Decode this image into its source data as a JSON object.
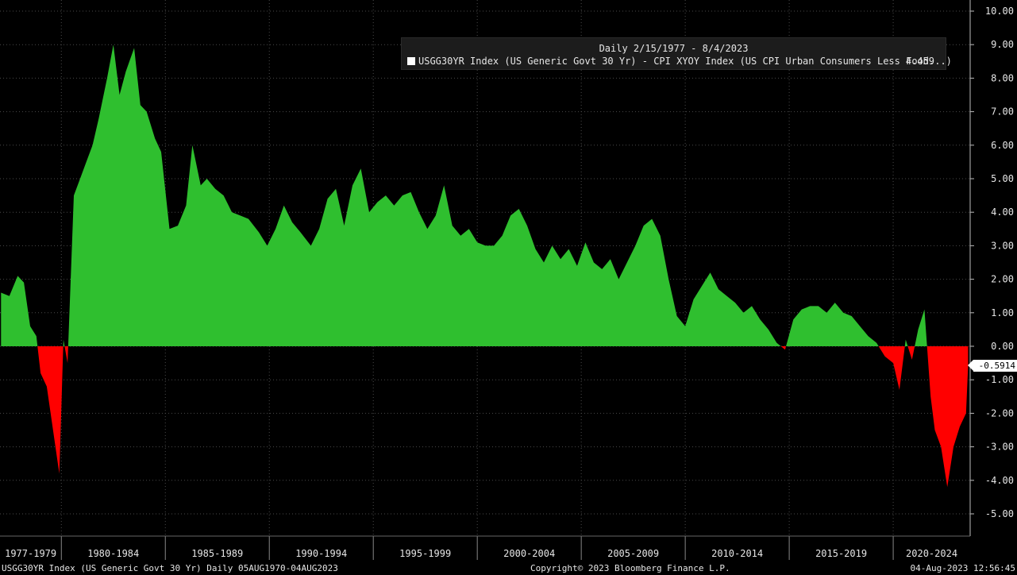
{
  "chart_data": {
    "type": "area",
    "title": "Daily 2/15/1977 - 8/4/2023",
    "series": [
      {
        "name": "USGG30YR Index (US Generic Govt 30 Yr) - CPI XYOY Index (US CPI Urban Consumers Less Food...)",
        "last_value": "4.459",
        "x": [
          1977.1,
          1977.5,
          1977.9,
          1978.2,
          1978.5,
          1978.8,
          1979.0,
          1979.3,
          1979.6,
          1979.9,
          1980.1,
          1980.3,
          1980.6,
          1980.9,
          1981.2,
          1981.5,
          1981.8,
          1982.2,
          1982.5,
          1982.8,
          1983.1,
          1983.5,
          1983.8,
          1984.1,
          1984.5,
          1984.8,
          1985.2,
          1985.6,
          1986.0,
          1986.3,
          1986.7,
          1987.0,
          1987.4,
          1987.8,
          1988.2,
          1988.6,
          1989.0,
          1989.5,
          1989.9,
          1990.3,
          1990.7,
          1991.1,
          1991.5,
          1992.0,
          1992.4,
          1992.8,
          1993.2,
          1993.6,
          1994.0,
          1994.4,
          1994.8,
          1995.2,
          1995.6,
          1996.0,
          1996.4,
          1996.8,
          1997.2,
          1997.6,
          1998.0,
          1998.4,
          1998.8,
          1999.2,
          1999.6,
          2000.0,
          2000.4,
          2000.8,
          2001.2,
          2001.6,
          2002.0,
          2002.4,
          2002.8,
          2003.2,
          2003.6,
          2004.0,
          2004.4,
          2004.8,
          2005.2,
          2005.6,
          2006.0,
          2006.4,
          2006.8,
          2007.2,
          2007.6,
          2008.0,
          2008.4,
          2008.8,
          2009.2,
          2009.6,
          2010.0,
          2010.4,
          2010.8,
          2011.2,
          2011.6,
          2012.0,
          2012.4,
          2012.8,
          2013.2,
          2013.6,
          2014.0,
          2014.4,
          2014.8,
          2015.2,
          2015.6,
          2016.0,
          2016.4,
          2016.8,
          2017.2,
          2017.6,
          2018.0,
          2018.4,
          2018.8,
          2019.2,
          2019.6,
          2020.0,
          2020.3,
          2020.6,
          2020.9,
          2021.2,
          2021.5,
          2021.8,
          2022.0,
          2022.3,
          2022.6,
          2022.9,
          2023.2,
          2023.5,
          2023.6
        ],
        "values": [
          1.6,
          1.5,
          2.1,
          1.9,
          0.6,
          0.3,
          -0.8,
          -1.2,
          -2.5,
          -3.8,
          0.2,
          -0.5,
          4.5,
          5.0,
          5.5,
          6.0,
          6.8,
          8.0,
          9.0,
          7.5,
          8.2,
          8.9,
          7.2,
          7.0,
          6.2,
          5.8,
          3.5,
          3.6,
          4.2,
          6.0,
          4.8,
          5.0,
          4.7,
          4.5,
          4.0,
          3.9,
          3.8,
          3.4,
          3.0,
          3.5,
          4.2,
          3.7,
          3.4,
          3.0,
          3.5,
          4.4,
          4.7,
          3.6,
          4.8,
          5.3,
          4.0,
          4.3,
          4.5,
          4.2,
          4.5,
          4.6,
          4.0,
          3.5,
          3.9,
          4.8,
          3.6,
          3.3,
          3.5,
          3.1,
          3.0,
          3.0,
          3.3,
          3.9,
          4.1,
          3.6,
          2.9,
          2.5,
          3.0,
          2.6,
          2.9,
          2.4,
          3.1,
          2.5,
          2.3,
          2.6,
          2.0,
          2.5,
          3.0,
          3.6,
          3.8,
          3.3,
          2.0,
          0.9,
          0.6,
          1.4,
          1.8,
          2.2,
          1.7,
          1.5,
          1.3,
          1.0,
          1.2,
          0.8,
          0.5,
          0.1,
          -0.1,
          0.8,
          1.1,
          1.2,
          1.2,
          1.0,
          1.3,
          1.0,
          0.9,
          0.6,
          0.3,
          0.1,
          -0.3,
          -0.5,
          -1.3,
          0.2,
          -0.4,
          0.5,
          1.1,
          -1.5,
          -2.5,
          -3.0,
          -4.2,
          -3.0,
          -2.4,
          -2.0,
          -0.59
        ]
      }
    ],
    "last_value_label": "-0.5914",
    "xlim": [
      1977.05,
      1923.6
    ],
    "ylim": [
      -5.5,
      10.4
    ],
    "y_ticks": [
      -5,
      -4,
      -3,
      -2,
      -1,
      0,
      1,
      2,
      3,
      4,
      5,
      6,
      7,
      8,
      9,
      10
    ],
    "y_tick_labels": [
      "-5.00",
      "-4.00",
      "-3.00",
      "-2.00",
      "-1.00",
      "0.00",
      "1.00",
      "2.00",
      "3.00",
      "4.00",
      "5.00",
      "6.00",
      "7.00",
      "8.00",
      "9.00",
      "10.00"
    ],
    "x_periods": [
      {
        "label": "1977-1979",
        "start": 1977,
        "end": 1980
      },
      {
        "label": "1980-1984",
        "start": 1980,
        "end": 1985
      },
      {
        "label": "1985-1989",
        "start": 1985,
        "end": 1990
      },
      {
        "label": "1990-1994",
        "start": 1990,
        "end": 1995
      },
      {
        "label": "1995-1999",
        "start": 1995,
        "end": 2000
      },
      {
        "label": "2000-2004",
        "start": 2000,
        "end": 2005
      },
      {
        "label": "2005-2009",
        "start": 2005,
        "end": 2010
      },
      {
        "label": "2010-2014",
        "start": 2010,
        "end": 2015
      },
      {
        "label": "2015-2019",
        "start": 2015,
        "end": 2020
      },
      {
        "label": "2020-2024",
        "start": 2020,
        "end": 2025
      }
    ],
    "colors": {
      "positive": "#2fbf2f",
      "negative": "#ff0000",
      "grid": "#4a4a4a",
      "axis": "#bbbbbb"
    },
    "grid": true,
    "legend_position": "top-right"
  },
  "footer": {
    "left": "USGG30YR Index (US Generic Govt 30 Yr)  Daily 05AUG1970-04AUG2023",
    "center": "Copyright© 2023 Bloomberg Finance L.P.",
    "right": "04-Aug-2023 12:56:45"
  }
}
